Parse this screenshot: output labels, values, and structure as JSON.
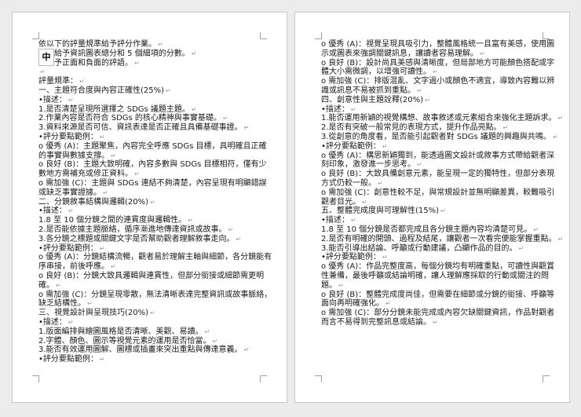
{
  "ime_indicator": "中",
  "left_page": [
    {
      "t": "依以下的評量規準給予評分作業。",
      "p": 1
    },
    {
      "t": "　　給予資訊圖表總分和 5 個細項的分數。",
      "p": 1
    },
    {
      "t": "　　予正面和負面的評語。",
      "p": 1
    },
    {
      "t": "",
      "p": 1
    },
    {
      "t": "評量規準：",
      "p": 1
    },
    {
      "t": "一、主題符合度與內容正確性(25%)",
      "p": 1
    },
    {
      "t": "•描述：",
      "p": 1
    },
    {
      "t": "1.是否清楚呈現所選擇之 SDGs 議題主題。",
      "p": 1
    },
    {
      "t": "2.作業內容是否符合 SDGs 的核心精神與事實基礎。",
      "p": 1
    },
    {
      "t": "3.資料來源是否可信、資訊表達是否正確且具備基礎事證。",
      "p": 1
    },
    {
      "t": "•評分要點範例：",
      "p": 1
    },
    {
      "t": "o 優秀 (A)：主題聚焦，內容完全呼應 SDGs 目標，具明確且正確",
      "p": 0
    },
    {
      "t": "的事實與數據支撐。",
      "p": 1
    },
    {
      "t": "o 良好 (B)：主題大致明確，內容多數與 SDGs 目標相符，僅有少",
      "p": 0
    },
    {
      "t": "數地方需補充或修正資料。",
      "p": 1
    },
    {
      "t": "o 需加強 (C)：主題與 SDGs 連結不夠清楚，內容呈現有明顯錯誤",
      "p": 0
    },
    {
      "t": "或缺乏事實證據。",
      "p": 1
    },
    {
      "t": "二、分鏡敘事結構與邏輯(20%)",
      "p": 1
    },
    {
      "t": "•描述：",
      "p": 1
    },
    {
      "t": "1.8 至 10 個分鏡之間的連貫度與邏輯性。",
      "p": 1
    },
    {
      "t": "2.是否能依據主題脈絡，循序漸進地傳達資訊或故事。",
      "p": 1
    },
    {
      "t": "3.各分鏡之標題或關鍵文字是否幫助觀者理解敘事走向。",
      "p": 1
    },
    {
      "t": "•評分要點範例：",
      "p": 1
    },
    {
      "t": "o 優秀 (A)：分鏡結構流暢，觀者易於理解主軸與細節，各分鏡能有",
      "p": 0
    },
    {
      "t": "序串接，前後呼應。",
      "p": 1
    },
    {
      "t": "o 良好 (B)：分鏡大致具邏輯與連貫性，但部分銜接或細節需更明",
      "p": 0
    },
    {
      "t": "確。",
      "p": 1
    },
    {
      "t": "o 需加強 (C)：分鏡呈現零散，無法清晰表達完整資訊或故事脈絡，",
      "p": 0
    },
    {
      "t": "缺乏結構性。",
      "p": 1
    },
    {
      "t": "三、視覺設計與呈現技巧(20%)",
      "p": 1
    },
    {
      "t": "•描述：",
      "p": 1
    },
    {
      "t": "1.版面編排與繪圖風格是否清晰、美觀、易讀。",
      "p": 1
    },
    {
      "t": "2.字體、顏色、圖示等視覺元素的運用是否恰當。",
      "p": 1
    },
    {
      "t": "3.能否有效運用圖解、圖標或插畫來突出重點與傳達意義。",
      "p": 1
    },
    {
      "t": "•評分要點範例：",
      "p": 1
    }
  ],
  "right_page": [
    {
      "t": "o 優秀 (A)：視覺呈現具吸引力，整體風格統一且富有美感，使用圖",
      "p": 0
    },
    {
      "t": "示或圖表來強調關鍵訊息，讓讀者容易理解。",
      "p": 1
    },
    {
      "t": "o 良好 (B)：設計尚具美感與清晰度，但局部地方可能顏色搭配或字",
      "p": 0
    },
    {
      "t": "體大小需微調，以增強可讀性。",
      "p": 1
    },
    {
      "t": "o 需加強 (C)：排版混亂、文字過小或顏色不適宜，導致內容難以辨",
      "p": 0
    },
    {
      "t": "識或訊息不易被抓到重點。",
      "p": 1
    },
    {
      "t": "四、創意性與主題詮釋(20%)",
      "p": 1
    },
    {
      "t": "•描述：",
      "p": 1
    },
    {
      "t": "1.能否運用新穎的視覺構想、故事敘述或元素組合來強化主題訴求。",
      "p": 1
    },
    {
      "t": "2.是否有突破一般常見的表現方式，提升作品亮點。",
      "p": 1
    },
    {
      "t": "3.從創意的角度看，是否能引起觀者對 SDGs 議題的興趣與共鳴。",
      "p": 1
    },
    {
      "t": "•評分要點範例：",
      "p": 1
    },
    {
      "t": "o 優秀 (A)：構思新穎獨到，能透過圖文設計或敘事方式帶給觀者深",
      "p": 0
    },
    {
      "t": "刻印象，激發進一步思考。",
      "p": 1
    },
    {
      "t": "o 良好 (B)：大致具備創意元素，能呈現一定的獨特性，但部分表現",
      "p": 0
    },
    {
      "t": "方式仍較一般。",
      "p": 1
    },
    {
      "t": "o 需加強 (C)：創意性較不足，與常規設計並無明顯差異，較難吸引",
      "p": 0
    },
    {
      "t": "觀者目光。",
      "p": 1
    },
    {
      "t": "五、整體完成度與可理解性(15%)",
      "p": 1
    },
    {
      "t": "•描述：",
      "p": 1
    },
    {
      "t": "1.8 至 10 個分鏡是否都完成且各分鏡主題內容均清楚可見。",
      "p": 1
    },
    {
      "t": "2.是否有明確的開頭、過程及結尾，讓觀者一次看完便能掌握重點。",
      "p": 1
    },
    {
      "t": "3.能否引導出結論、呼籲或行動建議，凸顯作品的目的。",
      "p": 1
    },
    {
      "t": "•評分要點範例：",
      "p": 1
    },
    {
      "t": "o 優秀 (A)：作品完整度高，每個分鏡均有明確重點，可讀性與觀賞",
      "p": 0
    },
    {
      "t": "性兼備，最後呼籲或結論明確，讓人理解應採取的行動或關注的問",
      "p": 0
    },
    {
      "t": "題。",
      "p": 1
    },
    {
      "t": "o 良好 (B)：整體完成度尚佳，但需要在細節或分鏡的銜接、呼籲等",
      "p": 0
    },
    {
      "t": "面向再明確強化。",
      "p": 1
    },
    {
      "t": "o 需加強 (C)：部分分鏡未能完成或內容欠缺關鍵資訊，作品對觀者",
      "p": 0
    },
    {
      "t": "而言不易得到完整訊息或結論。",
      "p": 1
    }
  ]
}
